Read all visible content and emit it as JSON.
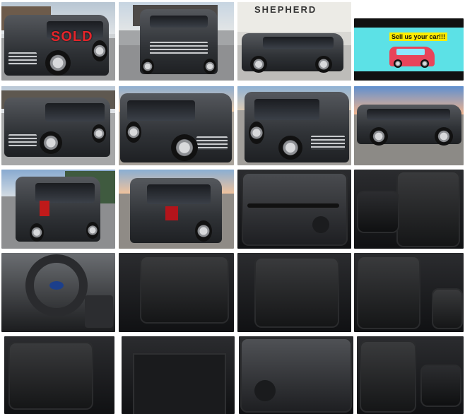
{
  "gallery": {
    "overlays": {
      "sold_label": "SOLD",
      "dealer_sign": "SHEPHERD",
      "sell_banner": "Sell us your car!!!"
    },
    "photos": [
      {
        "icon": "suv-front-quarter-sold"
      },
      {
        "icon": "suv-front"
      },
      {
        "icon": "suv-side-dealer"
      },
      {
        "icon": "sell-us-your-car-ad"
      },
      {
        "icon": "suv-front-quarter"
      },
      {
        "icon": "suv-front-quarter-sunset"
      },
      {
        "icon": "suv-front-quarter-dealer"
      },
      {
        "icon": "suv-side-sunset"
      },
      {
        "icon": "suv-rear-quarter"
      },
      {
        "icon": "suv-rear-sunset"
      },
      {
        "icon": "door-panel"
      },
      {
        "icon": "front-seat"
      },
      {
        "icon": "dashboard-steering-wheel"
      },
      {
        "icon": "rear-seat"
      },
      {
        "icon": "second-row-seats"
      },
      {
        "icon": "second-row-seat-detail"
      },
      {
        "icon": "third-row-seats"
      },
      {
        "icon": "cargo-area"
      },
      {
        "icon": "rear-door-panel"
      },
      {
        "icon": "front-seat-console"
      }
    ],
    "colors": {
      "sold_red": "#e3252b",
      "ad_background": "#5ce1e6",
      "ad_banner": "#ffec00",
      "vehicle_gray": "#3a3d41"
    }
  }
}
